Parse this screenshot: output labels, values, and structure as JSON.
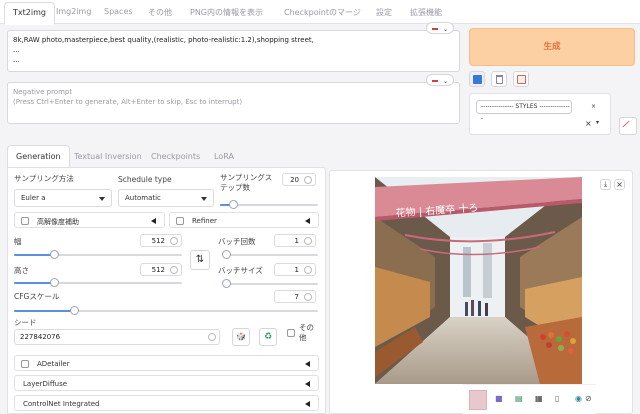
{
  "tabs": [
    "Txt2img",
    "Img2img",
    "Spaces",
    "その他",
    "PNG内の情報を表示",
    "Checkpointのマージ",
    "設定",
    "拡張機能"
  ],
  "prompt": {
    "lines": [
      "8k,RAW photo,masterpiece,best quality,(realistic, photo-realistic:1.2),shopping street,",
      "...",
      "..."
    ]
  },
  "negative_prompt": {
    "title": "Negative prompt",
    "hint": "(Press Ctrl+Enter to generate, Alt+Enter to skip, Esc to interrupt)"
  },
  "generate_label": "生成",
  "styles": {
    "chip": "--------------- STYLES ---------------",
    "chip_remove": "×",
    "clear": "×"
  },
  "subtabs": [
    "Generation",
    "Textual Inversion",
    "Checkpoints",
    "LoRA"
  ],
  "sampling": {
    "method_label": "サンプリング方法",
    "method_value": "Euler a",
    "schedule_label": "Schedule type",
    "schedule_value": "Automatic",
    "steps_label_1": "サンプリングス",
    "steps_label_2": "テップ数",
    "steps_value": "20",
    "steps_fraction": 0.14
  },
  "hires": {
    "label": "高解像度補助"
  },
  "refiner": {
    "label": "Refiner"
  },
  "size": {
    "width_label": "幅",
    "width_value": "512",
    "width_fraction": 0.24,
    "height_label": "高さ",
    "height_value": "512",
    "height_fraction": 0.24
  },
  "batch": {
    "count_label": "バッチ回数",
    "count_value": "1",
    "count_fraction": 0.0,
    "size_label": "バッチサイズ",
    "size_value": "1",
    "size_fraction": 0.0
  },
  "cfg": {
    "label": "CFGスケール",
    "value": "7",
    "fraction": 0.2
  },
  "seed": {
    "label": "シード",
    "value": "227842076",
    "extra_label_1": "その",
    "extra_label_2": "他"
  },
  "accordions": [
    "ADetailer",
    "LayerDiffuse",
    "ControlNet Integrated"
  ],
  "output": {
    "banner_text": "花物 | 右魔卒 十ろ",
    "close_glyph": "×",
    "download_glyph": "⤓"
  },
  "colors": {
    "generate_bg": "#fdd0a4",
    "generate_text": "#e8703a",
    "slider_fill": "#5c8fe0"
  }
}
